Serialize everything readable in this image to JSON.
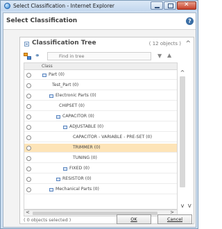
{
  "window": {
    "title": "Select Classification - Internet Explorer"
  },
  "dialog": {
    "title": "Select Classification"
  },
  "panel": {
    "title": "Classification Tree",
    "count": "( 12 objects )",
    "search_placeholder": "Find in tree",
    "column_header": "Class",
    "status": "( 0 objects selected )"
  },
  "tree": [
    {
      "label": "Part (0)",
      "has_icon": true
    },
    {
      "label": "Test_Part (0)",
      "has_icon": false
    },
    {
      "label": "Electronic Parts (0)",
      "has_icon": true
    },
    {
      "label": "CHIPSET (0)",
      "has_icon": false
    },
    {
      "label": "CAPACITOR (0)",
      "has_icon": true
    },
    {
      "label": "ADJUSTABLE (0)",
      "has_icon": true
    },
    {
      "label": "CAPACITOR - VARIABLE - PRE-SET (0)",
      "has_icon": false
    },
    {
      "label": "TRIMMER (0)",
      "has_icon": false,
      "selected": true
    },
    {
      "label": "TUNING (0)",
      "has_icon": false
    },
    {
      "label": "FIXED (0)",
      "has_icon": true
    },
    {
      "label": "RESISTOR (0)",
      "has_icon": true
    },
    {
      "label": "Mechanical Parts (0)",
      "has_icon": true
    }
  ],
  "buttons": {
    "ok": "OK",
    "cancel": "Cancel"
  },
  "colors": {
    "selected_row": "#fde4b8",
    "title_bar": "#cfe0f2",
    "close_button": "#c7402a"
  }
}
